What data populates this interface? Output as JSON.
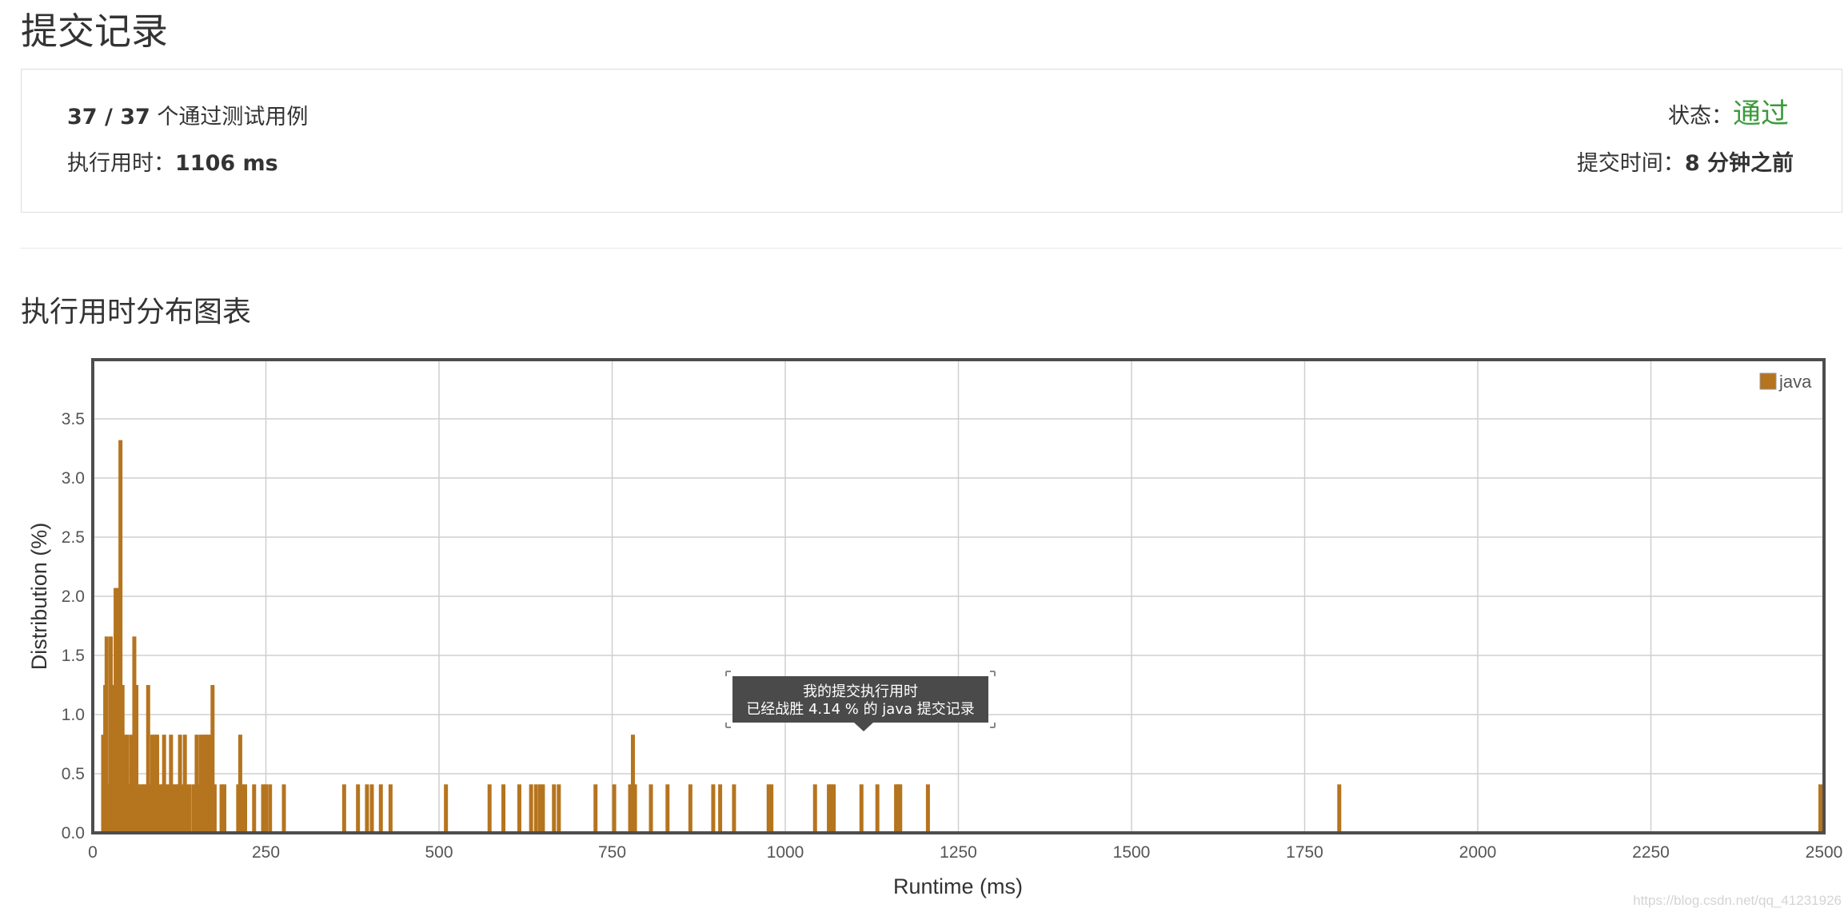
{
  "page": {
    "title": "提交记录",
    "watermark": "https://blog.csdn.net/qq_41231926"
  },
  "summary": {
    "cases_passed": "37 / 37",
    "cases_suffix": " 个通过测试用例",
    "runtime_label": "执行用时：",
    "runtime_value": "1106 ms",
    "status_label": "状态：",
    "status_value": "通过",
    "submit_time_label": "提交时间：",
    "submit_time_value": "8 分钟之前"
  },
  "section": {
    "title": "执行用时分布图表"
  },
  "colors": {
    "bar": "#b5741e",
    "status_ok": "#3c9a3c",
    "tooltip_bg": "#4a4a4a"
  },
  "chart_data": {
    "type": "bar",
    "title": "",
    "xlabel": "Runtime (ms)",
    "ylabel": "Distribution (%)",
    "xlim": [
      0,
      2500
    ],
    "ylim": [
      0,
      4.0
    ],
    "xticks": [
      0,
      250,
      500,
      750,
      1000,
      1250,
      1500,
      1750,
      2000,
      2250,
      2500
    ],
    "yticks": [
      0.0,
      0.5,
      1.0,
      1.5,
      2.0,
      2.5,
      3.0,
      3.5
    ],
    "ytick_labels": [
      "0.0",
      "0.5",
      "1.0",
      "1.5",
      "2.0",
      "2.5",
      "3.0",
      "3.5"
    ],
    "grid": true,
    "legend": "top-right",
    "series": [
      {
        "name": "java",
        "color": "#b5741e",
        "points": [
          [
            15,
            0.83
          ],
          [
            18,
            1.25
          ],
          [
            20,
            1.66
          ],
          [
            23,
            0.41
          ],
          [
            26,
            1.66
          ],
          [
            30,
            1.25
          ],
          [
            33,
            2.07
          ],
          [
            36,
            2.07
          ],
          [
            40,
            3.32
          ],
          [
            43,
            1.25
          ],
          [
            46,
            0.83
          ],
          [
            50,
            0.83
          ],
          [
            53,
            0.41
          ],
          [
            56,
            0.83
          ],
          [
            60,
            1.66
          ],
          [
            63,
            1.25
          ],
          [
            66,
            0.41
          ],
          [
            70,
            0.41
          ],
          [
            73,
            0.41
          ],
          [
            76,
            0.41
          ],
          [
            80,
            1.25
          ],
          [
            83,
            0.41
          ],
          [
            86,
            0.83
          ],
          [
            90,
            0.83
          ],
          [
            93,
            0.83
          ],
          [
            96,
            0.41
          ],
          [
            100,
            0.41
          ],
          [
            103,
            0.83
          ],
          [
            106,
            0.41
          ],
          [
            110,
            0.41
          ],
          [
            113,
            0.83
          ],
          [
            116,
            0.41
          ],
          [
            120,
            0.41
          ],
          [
            123,
            0.41
          ],
          [
            126,
            0.83
          ],
          [
            130,
            0.41
          ],
          [
            133,
            0.83
          ],
          [
            136,
            0.41
          ],
          [
            140,
            0.41
          ],
          [
            146,
            0.41
          ],
          [
            150,
            0.83
          ],
          [
            153,
            0.41
          ],
          [
            156,
            0.83
          ],
          [
            160,
            0.83
          ],
          [
            163,
            0.83
          ],
          [
            166,
            0.83
          ],
          [
            170,
            0.83
          ],
          [
            173,
            1.25
          ],
          [
            176,
            0.41
          ],
          [
            186,
            0.41
          ],
          [
            190,
            0.41
          ],
          [
            210,
            0.41
          ],
          [
            213,
            0.83
          ],
          [
            216,
            0.41
          ],
          [
            220,
            0.41
          ],
          [
            233,
            0.41
          ],
          [
            246,
            0.41
          ],
          [
            250,
            0.41
          ],
          [
            256,
            0.41
          ],
          [
            276,
            0.41
          ],
          [
            363,
            0.41
          ],
          [
            383,
            0.41
          ],
          [
            396,
            0.41
          ],
          [
            403,
            0.41
          ],
          [
            416,
            0.41
          ],
          [
            430,
            0.41
          ],
          [
            510,
            0.41
          ],
          [
            573,
            0.41
          ],
          [
            593,
            0.41
          ],
          [
            616,
            0.41
          ],
          [
            633,
            0.41
          ],
          [
            640,
            0.41
          ],
          [
            646,
            0.41
          ],
          [
            650,
            0.41
          ],
          [
            666,
            0.41
          ],
          [
            673,
            0.41
          ],
          [
            726,
            0.41
          ],
          [
            753,
            0.41
          ],
          [
            776,
            0.41
          ],
          [
            780,
            0.83
          ],
          [
            783,
            0.41
          ],
          [
            806,
            0.41
          ],
          [
            830,
            0.41
          ],
          [
            863,
            0.41
          ],
          [
            896,
            0.41
          ],
          [
            906,
            0.41
          ],
          [
            926,
            0.41
          ],
          [
            976,
            0.41
          ],
          [
            980,
            0.41
          ],
          [
            1043,
            0.41
          ],
          [
            1063,
            0.41
          ],
          [
            1066,
            0.41
          ],
          [
            1070,
            0.41
          ],
          [
            1110,
            0.41
          ],
          [
            1133,
            0.41
          ],
          [
            1160,
            0.41
          ],
          [
            1163,
            0.41
          ],
          [
            1166,
            0.41
          ],
          [
            1206,
            0.41
          ],
          [
            1800,
            0.41
          ],
          [
            2500,
            0.41
          ]
        ]
      }
    ],
    "annotation": {
      "x": 1106,
      "line1": "我的提交执行用时",
      "line2": "已经战胜 4.14 % 的 java 提交记录"
    }
  }
}
